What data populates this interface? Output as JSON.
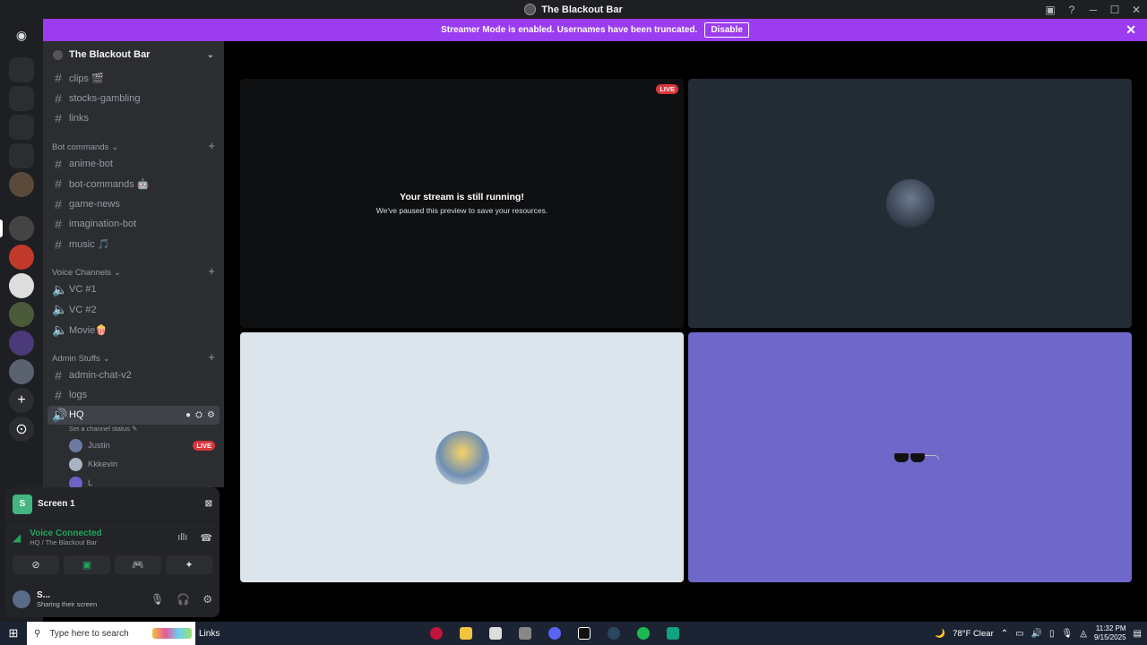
{
  "window": {
    "title": "The Blackout Bar"
  },
  "banner": {
    "message": "Streamer Mode is enabled. Usernames have been truncated.",
    "disable_label": "Disable"
  },
  "server": {
    "name": "The Blackout Bar"
  },
  "channels_top": [
    {
      "name": "clips 🎬"
    },
    {
      "name": "stocks-gambling"
    },
    {
      "name": "links"
    }
  ],
  "categories": {
    "bot": {
      "label": "Bot commands"
    },
    "voice": {
      "label": "Voice Channels"
    },
    "admin": {
      "label": "Admin Stuffs"
    }
  },
  "bot_channels": [
    {
      "name": "anime-bot"
    },
    {
      "name": "bot-commands 🤖"
    },
    {
      "name": "game-news"
    },
    {
      "name": "imagination-bot"
    },
    {
      "name": "music 🎵"
    }
  ],
  "voice_channels": [
    {
      "name": "VC #1"
    },
    {
      "name": "VC #2"
    },
    {
      "name": "Movie🍿"
    }
  ],
  "admin_channels": [
    {
      "name": "admin-chat-v2"
    },
    {
      "name": "logs"
    }
  ],
  "hq": {
    "name": "HQ",
    "status": "Set a channel status",
    "users": [
      {
        "name": "Justin",
        "live": "LIVE"
      },
      {
        "name": "Kkkevin"
      },
      {
        "name": "L"
      }
    ]
  },
  "screen_share": {
    "label": "Screen 1"
  },
  "voice_status": {
    "state": "Voice Connected",
    "location": "HQ / The Blackout Bar"
  },
  "user": {
    "name": "S...",
    "status": "Sharing their screen"
  },
  "stage": {
    "live_label": "LIVE",
    "paused_title": "Your stream is still running!",
    "paused_sub": "We've paused this preview to save your resources."
  },
  "taskbar": {
    "search_placeholder": "Type here to search",
    "links_label": "Links",
    "weather": "78°F  Clear",
    "time": "11:32 PM",
    "date": "9/15/2025"
  },
  "colors": {
    "banner": "#9b3cf0",
    "live": "#da373c",
    "connected": "#23a55a",
    "tile4_bg": "#6f68c9"
  }
}
